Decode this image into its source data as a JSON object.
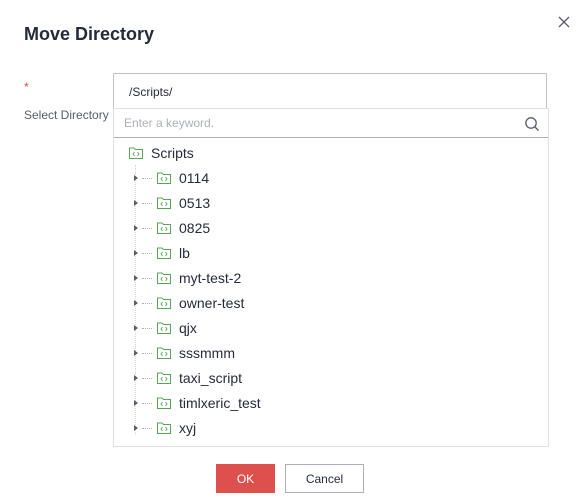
{
  "dialog": {
    "title": "Move Directory",
    "required_mark": "*",
    "field_label": "Select Directory",
    "selected_value": "/Scripts/",
    "search": {
      "placeholder": "Enter a keyword.",
      "value": ""
    },
    "tree": {
      "root": "Scripts",
      "children": [
        "0114",
        "0513",
        "0825",
        "lb",
        "myt-test-2",
        "owner-test",
        "qjx",
        "sssmmm",
        "taxi_script",
        "timlxeric_test",
        "xyj"
      ]
    },
    "buttons": {
      "ok": "OK",
      "cancel": "Cancel"
    },
    "colors": {
      "primary": "#de504e",
      "folder_icon": "#5aa45a",
      "required": "#e54545"
    }
  }
}
